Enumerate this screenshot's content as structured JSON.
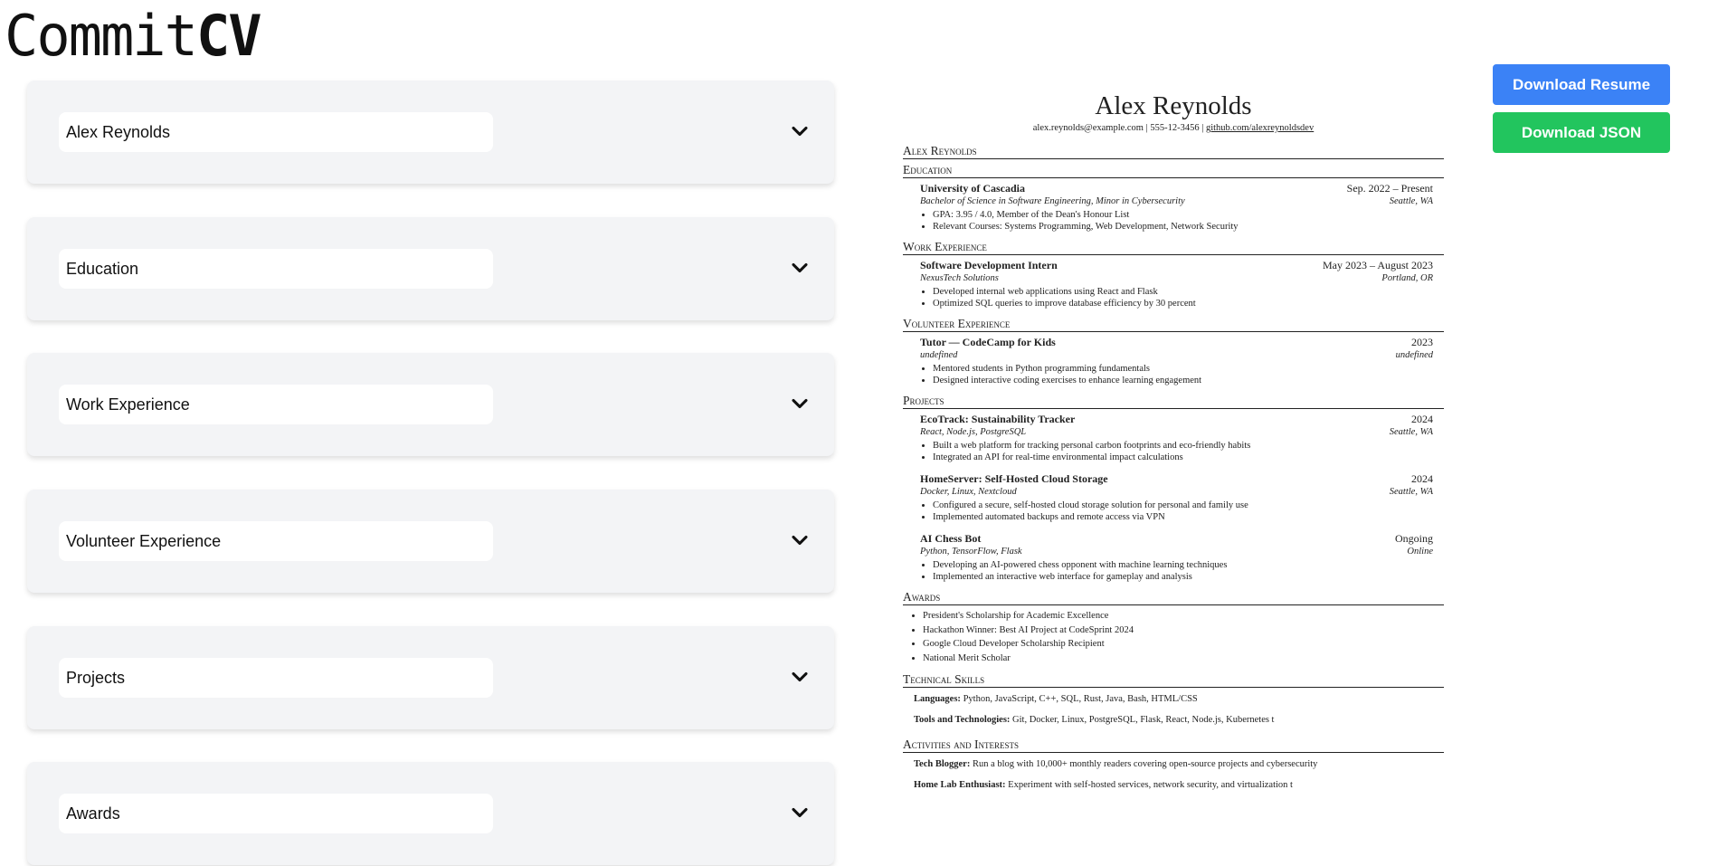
{
  "logo": {
    "light": "Commit",
    "bold": "CV"
  },
  "sections": [
    {
      "value": "Alex Reynolds",
      "icon": "chevron-down-icon"
    },
    {
      "value": "Education",
      "icon": "chevron-down-icon"
    },
    {
      "value": "Work Experience",
      "icon": "chevron-down-icon"
    },
    {
      "value": "Volunteer Experience",
      "icon": "chevron-down-icon"
    },
    {
      "value": "Projects",
      "icon": "chevron-down-icon"
    },
    {
      "value": "Awards",
      "icon": "chevron-down-icon"
    }
  ],
  "buttons": {
    "download_resume": "Download Resume",
    "download_json": "Download JSON",
    "resume_color": "#3b82f6",
    "json_color": "#22c55e"
  },
  "resume": {
    "name": "Alex Reynolds",
    "contact": {
      "email": "alex.reynolds@example.com",
      "sep": " | ",
      "phone": "555-12-3456",
      "github": "github.com/alexreynoldsdev"
    },
    "header_title": "Alex Reynolds",
    "education": {
      "title": "Education",
      "entries": [
        {
          "name": "University of Cascadia",
          "date": "Sep. 2022 – Present",
          "sub": "Bachelor of Science in Software Engineering, Minor in Cybersecurity",
          "location": "Seattle, WA",
          "bullets": [
            "GPA: 3.95 / 4.0, Member of the Dean's Honour List",
            "Relevant Courses: Systems Programming, Web Development, Network Security"
          ]
        }
      ]
    },
    "work": {
      "title": "Work Experience",
      "entries": [
        {
          "name": "Software Development Intern",
          "date": "May 2023 – August 2023",
          "sub": "NexusTech Solutions",
          "location": "Portland, OR",
          "bullets": [
            "Developed internal web applications using React and Flask",
            "Optimized SQL queries to improve database efficiency by 30 percent"
          ]
        }
      ]
    },
    "volunteer": {
      "title": "Volunteer Experience",
      "entries": [
        {
          "name": "Tutor — CodeCamp for Kids",
          "date": "2023",
          "sub": "undefined",
          "location": "undefined",
          "bullets": [
            "Mentored students in Python programming fundamentals",
            "Designed interactive coding exercises to enhance learning engagement"
          ]
        }
      ]
    },
    "projects": {
      "title": "Projects",
      "entries": [
        {
          "name": "EcoTrack: Sustainability Tracker",
          "date": "2024",
          "sub": "React, Node.js, PostgreSQL",
          "location": "Seattle, WA",
          "bullets": [
            "Built a web platform for tracking personal carbon footprints and eco-friendly habits",
            "Integrated an API for real-time environmental impact calculations"
          ]
        },
        {
          "name": "HomeServer: Self-Hosted Cloud Storage",
          "date": "2024",
          "sub": "Docker, Linux, Nextcloud",
          "location": "Seattle, WA",
          "bullets": [
            "Configured a secure, self-hosted cloud storage solution for personal and family use",
            "Implemented automated backups and remote access via VPN"
          ]
        },
        {
          "name": "AI Chess Bot",
          "date": "Ongoing",
          "sub": "Python, TensorFlow, Flask",
          "location": "Online",
          "bullets": [
            "Developing an AI-powered chess opponent with machine learning techniques",
            "Implemented an interactive web interface for gameplay and analysis"
          ]
        }
      ]
    },
    "awards": {
      "title": "Awards",
      "items": [
        "President's Scholarship for Academic Excellence",
        "Hackathon Winner: Best AI Project at CodeSprint 2024",
        "Google Cloud Developer Scholarship Recipient",
        "National Merit Scholar"
      ]
    },
    "skills": {
      "title": "Technical Skills",
      "items": [
        {
          "label": "Languages:",
          "value": "Python, JavaScript, C++, SQL, Rust, Java, Bash, HTML/CSS"
        },
        {
          "label": "Tools and Technologies:",
          "value": "Git, Docker, Linux, PostgreSQL, Flask, React, Node.js, Kubernetes t"
        }
      ]
    },
    "activities": {
      "title": "Activities and Interests",
      "items": [
        {
          "label": "Tech Blogger:",
          "value": "Run a blog with 10,000+ monthly readers covering open-source projects and cybersecurity"
        },
        {
          "label": "Home Lab Enthusiast:",
          "value": "Experiment with self-hosted services, network security, and virtualization t"
        }
      ]
    }
  }
}
